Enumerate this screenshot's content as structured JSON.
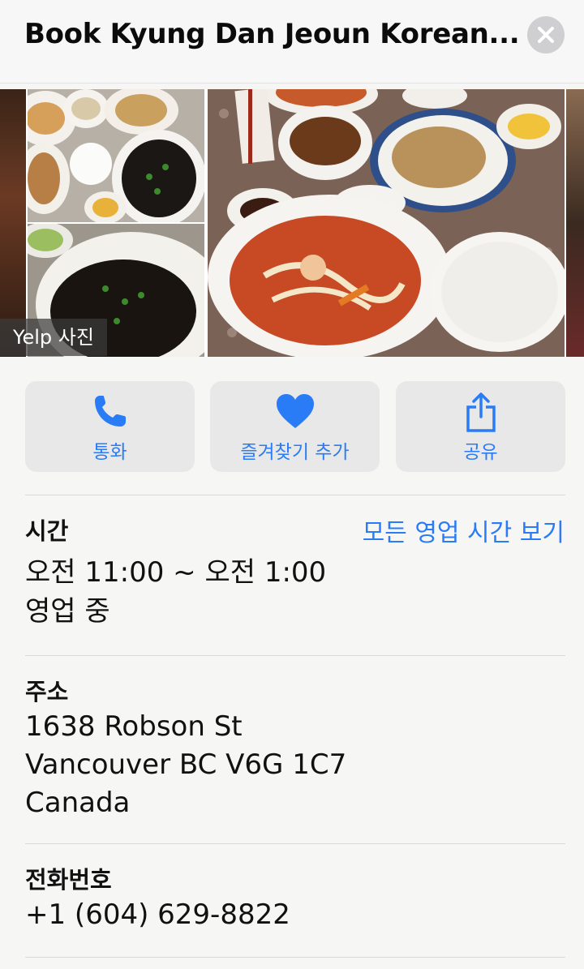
{
  "header": {
    "title": "Book Kyung Dan Jeoun Korean...",
    "close_icon": "close-icon"
  },
  "gallery": {
    "source_label": "Yelp 사진"
  },
  "actions": [
    {
      "label": "통화",
      "icon": "phone-icon"
    },
    {
      "label": "즐겨찾기 추가",
      "icon": "heart-icon"
    },
    {
      "label": "공유",
      "icon": "share-icon"
    }
  ],
  "hours": {
    "heading": "시간",
    "link": "모든 영업 시간 보기",
    "range": "오전 11:00 ~ 오전 1:00",
    "status": "영업 중"
  },
  "address": {
    "heading": "주소",
    "line1": "1638 Robson St",
    "line2": "Vancouver BC V6G 1C7",
    "line3": "Canada"
  },
  "phone": {
    "heading": "전화번호",
    "number": "+1 (604) 629-8822"
  },
  "colors": {
    "accent": "#2a7cf6",
    "button_bg": "#e8e8e8",
    "background": "#f6f6f5"
  }
}
